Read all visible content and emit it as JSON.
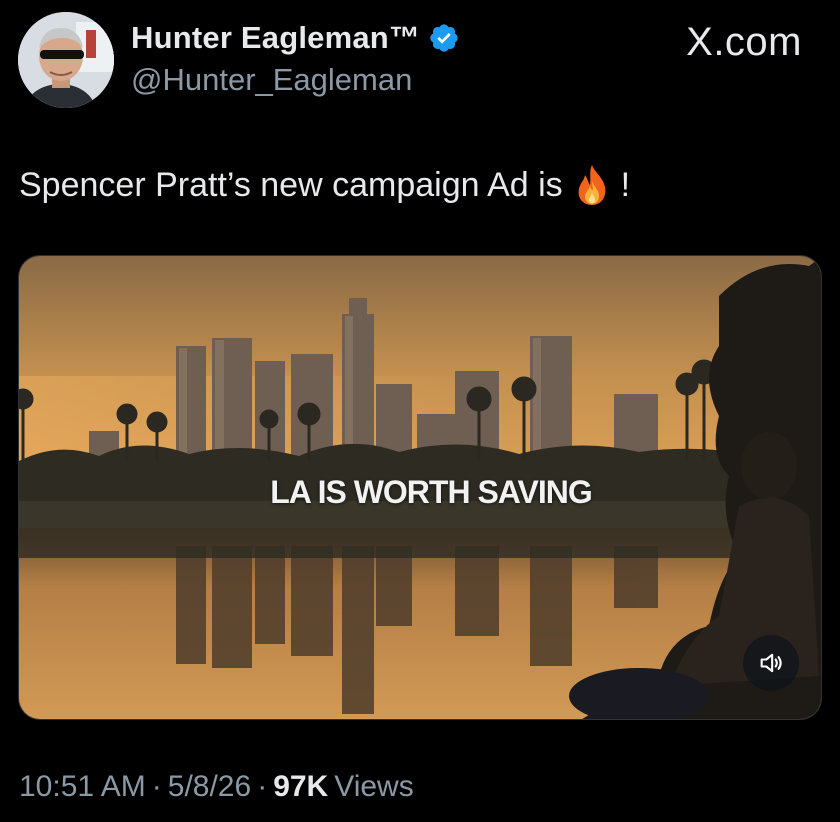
{
  "author": {
    "display_name": "Hunter Eagleman™",
    "handle": "@Hunter_Eagleman",
    "verified": true,
    "avatar_icon": "profile-photo"
  },
  "site_label": "X.com",
  "tweet": {
    "text": "Spencer Pratt’s new campaign Ad is",
    "emoji": "fire-icon",
    "trailing": "!"
  },
  "media": {
    "overlay_text": "LA IS WORTH SAVING",
    "sound_icon": "speaker-icon"
  },
  "meta": {
    "time": "10:51 AM",
    "sep1": "·",
    "date": "5/8/26",
    "sep2": "·",
    "views_count": "97K",
    "views_label": "Views"
  },
  "colors": {
    "background": "#000000",
    "text_primary": "#e7e9ea",
    "text_secondary": "#8b98a5",
    "verified_blue": "#1d9bf0"
  }
}
